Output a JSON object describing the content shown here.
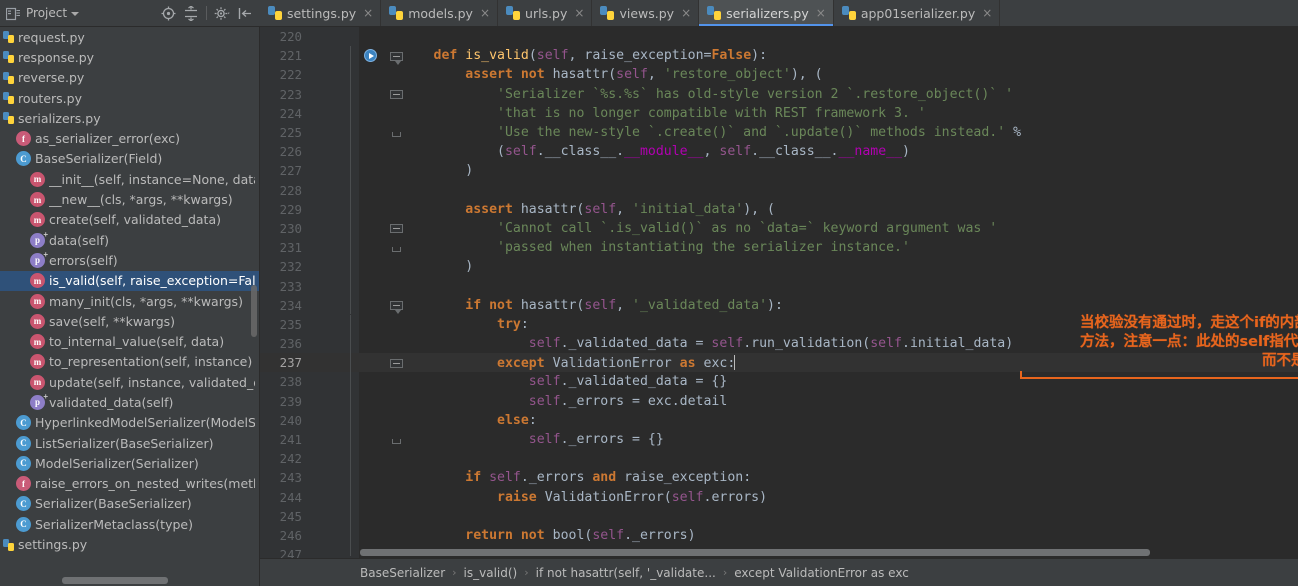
{
  "window": {
    "theme_bg": "#2b2b2b",
    "panel_bg": "#3c3f41",
    "accent": "#5394ec",
    "annotation_color": "#e8651d"
  },
  "project_panel": {
    "title": "Project",
    "icon": "project-view-icon",
    "caret": "chevron-down-icon",
    "toolbar": [
      {
        "name": "locate-in-tree-icon",
        "glyph": "target"
      },
      {
        "name": "collapse-all-icon",
        "glyph": "collapse"
      },
      {
        "name": "settings-gear-icon",
        "glyph": "gear"
      },
      {
        "name": "hide-panel-icon",
        "glyph": "hide"
      }
    ]
  },
  "tree": {
    "items": [
      {
        "label": "request.py",
        "icon": "python-file-icon",
        "indent": 0,
        "selected": false
      },
      {
        "label": "response.py",
        "icon": "python-file-icon",
        "indent": 0,
        "selected": false
      },
      {
        "label": "reverse.py",
        "icon": "python-file-icon",
        "indent": 0,
        "selected": false
      },
      {
        "label": "routers.py",
        "icon": "python-file-icon",
        "indent": 0,
        "selected": false
      },
      {
        "label": "serializers.py",
        "icon": "python-file-icon",
        "indent": 0,
        "selected": false
      },
      {
        "label": "as_serializer_error(exc)",
        "icon": "function-icon",
        "indent": 1,
        "selected": false
      },
      {
        "label": "BaseSerializer(Field)",
        "icon": "class-icon",
        "indent": 1,
        "selected": false
      },
      {
        "label": "__init__(self, instance=None, data=emp",
        "icon": "method-icon",
        "indent": 2,
        "selected": false
      },
      {
        "label": "__new__(cls, *args, **kwargs)",
        "icon": "method-icon",
        "indent": 2,
        "selected": false
      },
      {
        "label": "create(self, validated_data)",
        "icon": "method-icon",
        "indent": 2,
        "selected": false
      },
      {
        "label": "data(self)",
        "icon": "property-icon",
        "indent": 2,
        "selected": false
      },
      {
        "label": "errors(self)",
        "icon": "property-icon",
        "indent": 2,
        "selected": false
      },
      {
        "label": "is_valid(self, raise_exception=False)",
        "icon": "method-icon",
        "indent": 2,
        "selected": true
      },
      {
        "label": "many_init(cls, *args, **kwargs)",
        "icon": "method-icon",
        "indent": 2,
        "selected": false
      },
      {
        "label": "save(self, **kwargs)",
        "icon": "method-icon",
        "indent": 2,
        "selected": false
      },
      {
        "label": "to_internal_value(self, data)",
        "icon": "method-icon",
        "indent": 2,
        "selected": false
      },
      {
        "label": "to_representation(self, instance)",
        "icon": "method-icon",
        "indent": 2,
        "selected": false
      },
      {
        "label": "update(self, instance, validated_data)",
        "icon": "method-icon",
        "indent": 2,
        "selected": false
      },
      {
        "label": "validated_data(self)",
        "icon": "property-icon",
        "indent": 2,
        "selected": false
      },
      {
        "label": "HyperlinkedModelSerializer(ModelSeriali",
        "icon": "class-icon",
        "indent": 1,
        "selected": false
      },
      {
        "label": "ListSerializer(BaseSerializer)",
        "icon": "class-icon",
        "indent": 1,
        "selected": false
      },
      {
        "label": "ModelSerializer(Serializer)",
        "icon": "class-icon",
        "indent": 1,
        "selected": false
      },
      {
        "label": "raise_errors_on_nested_writes(method_na",
        "icon": "function-icon",
        "indent": 1,
        "selected": false
      },
      {
        "label": "Serializer(BaseSerializer)",
        "icon": "class-icon",
        "indent": 1,
        "selected": false
      },
      {
        "label": "SerializerMetaclass(type)",
        "icon": "class-icon",
        "indent": 1,
        "selected": false
      },
      {
        "label": "settings.py",
        "icon": "python-file-icon",
        "indent": 0,
        "selected": false
      }
    ]
  },
  "tabs": [
    {
      "label": "settings.py",
      "active": false,
      "close": "×"
    },
    {
      "label": "models.py",
      "active": false,
      "close": "×"
    },
    {
      "label": "urls.py",
      "active": false,
      "close": "×"
    },
    {
      "label": "views.py",
      "active": false,
      "close": "×"
    },
    {
      "label": "serializers.py",
      "active": true,
      "close": "×"
    },
    {
      "label": "app01serializer.py",
      "active": false,
      "close": "×"
    }
  ],
  "editor": {
    "first_line": 220,
    "current_line": 237,
    "lines": [
      {
        "n": 220,
        "tokens": []
      },
      {
        "n": 221,
        "gutter": "run-icon",
        "fold": "open-arrow",
        "tokens": [
          {
            "t": "        ",
            "c": "pln"
          },
          {
            "t": "def ",
            "c": "kw"
          },
          {
            "t": "is_valid",
            "c": "fn"
          },
          {
            "t": "(",
            "c": "pln"
          },
          {
            "t": "self",
            "c": "slf"
          },
          {
            "t": ", raise_exception=",
            "c": "pln"
          },
          {
            "t": "False",
            "c": "kw"
          },
          {
            "t": "):",
            "c": "pln"
          }
        ]
      },
      {
        "n": 222,
        "tokens": [
          {
            "t": "            ",
            "c": "pln"
          },
          {
            "t": "assert not ",
            "c": "kw"
          },
          {
            "t": "hasattr(",
            "c": "pln"
          },
          {
            "t": "self",
            "c": "slf"
          },
          {
            "t": ", ",
            "c": "pln"
          },
          {
            "t": "'restore_object'",
            "c": "str"
          },
          {
            "t": "), (",
            "c": "pln"
          }
        ]
      },
      {
        "n": 223,
        "fold": "open",
        "tokens": [
          {
            "t": "                ",
            "c": "pln"
          },
          {
            "t": "'Serializer `%s.%s` has old-style version 2 `.restore_object()` '",
            "c": "str"
          }
        ]
      },
      {
        "n": 224,
        "tokens": [
          {
            "t": "                ",
            "c": "pln"
          },
          {
            "t": "'that is no longer compatible with REST framework 3. '",
            "c": "str"
          }
        ]
      },
      {
        "n": 225,
        "fold": "end",
        "tokens": [
          {
            "t": "                ",
            "c": "pln"
          },
          {
            "t": "'Use the new-style `.create()` and `.update()` methods instead.'",
            "c": "str"
          },
          {
            "t": " %",
            "c": "pln"
          }
        ]
      },
      {
        "n": 226,
        "tokens": [
          {
            "t": "                (",
            "c": "pln"
          },
          {
            "t": "self",
            "c": "slf"
          },
          {
            "t": ".__class__.",
            "c": "pln"
          },
          {
            "t": "__module__",
            "c": "dnd"
          },
          {
            "t": ", ",
            "c": "pln"
          },
          {
            "t": "self",
            "c": "slf"
          },
          {
            "t": ".__class__.",
            "c": "pln"
          },
          {
            "t": "__name__",
            "c": "dnd"
          },
          {
            "t": ")",
            "c": "pln"
          }
        ]
      },
      {
        "n": 227,
        "tokens": [
          {
            "t": "            )",
            "c": "pln"
          }
        ]
      },
      {
        "n": 228,
        "tokens": []
      },
      {
        "n": 229,
        "tokens": [
          {
            "t": "            ",
            "c": "pln"
          },
          {
            "t": "assert ",
            "c": "kw"
          },
          {
            "t": "hasattr(",
            "c": "pln"
          },
          {
            "t": "self",
            "c": "slf"
          },
          {
            "t": ", ",
            "c": "pln"
          },
          {
            "t": "'initial_data'",
            "c": "str"
          },
          {
            "t": "), (",
            "c": "pln"
          }
        ]
      },
      {
        "n": 230,
        "fold": "open",
        "tokens": [
          {
            "t": "                ",
            "c": "pln"
          },
          {
            "t": "'Cannot call `.is_valid()` as no `data=` keyword argument was '",
            "c": "str"
          }
        ]
      },
      {
        "n": 231,
        "fold": "end",
        "tokens": [
          {
            "t": "                ",
            "c": "pln"
          },
          {
            "t": "'passed when instantiating the serializer instance.'",
            "c": "str"
          }
        ]
      },
      {
        "n": 232,
        "tokens": [
          {
            "t": "            )",
            "c": "pln"
          }
        ]
      },
      {
        "n": 233,
        "tokens": []
      },
      {
        "n": 234,
        "fold": "open-arrow",
        "tokens": [
          {
            "t": "            ",
            "c": "pln"
          },
          {
            "t": "if not ",
            "c": "kw"
          },
          {
            "t": "hasattr(",
            "c": "pln"
          },
          {
            "t": "self",
            "c": "slf"
          },
          {
            "t": ", ",
            "c": "pln"
          },
          {
            "t": "'_validated_data'",
            "c": "str"
          },
          {
            "t": "):",
            "c": "pln"
          }
        ]
      },
      {
        "n": 235,
        "tokens": [
          {
            "t": "                ",
            "c": "pln"
          },
          {
            "t": "try",
            "c": "kw"
          },
          {
            "t": ":",
            "c": "pln"
          }
        ]
      },
      {
        "n": 236,
        "tokens": [
          {
            "t": "                    ",
            "c": "pln"
          },
          {
            "t": "self",
            "c": "slf"
          },
          {
            "t": "._validated_data = ",
            "c": "pln"
          },
          {
            "t": "self",
            "c": "slf"
          },
          {
            "t": ".run_validation(",
            "c": "pln"
          },
          {
            "t": "self",
            "c": "slf"
          },
          {
            "t": ".initial_data)",
            "c": "pln"
          }
        ]
      },
      {
        "n": 237,
        "current": true,
        "fold": "open",
        "tokens": [
          {
            "t": "                ",
            "c": "pln"
          },
          {
            "t": "except ",
            "c": "kw"
          },
          {
            "t": "ValidationError ",
            "c": "cls"
          },
          {
            "t": "as ",
            "c": "kw"
          },
          {
            "t": "exc",
            "c": "pln"
          },
          {
            "t": ":",
            "c": "pln"
          }
        ],
        "caret_after": true
      },
      {
        "n": 238,
        "tokens": [
          {
            "t": "                    ",
            "c": "pln"
          },
          {
            "t": "self",
            "c": "slf"
          },
          {
            "t": "._validated_data = {}",
            "c": "pln"
          }
        ]
      },
      {
        "n": 239,
        "tokens": [
          {
            "t": "                    ",
            "c": "pln"
          },
          {
            "t": "self",
            "c": "slf"
          },
          {
            "t": "._errors = exc.detail",
            "c": "pln"
          }
        ]
      },
      {
        "n": 240,
        "tokens": [
          {
            "t": "                ",
            "c": "pln"
          },
          {
            "t": "else",
            "c": "kw"
          },
          {
            "t": ":",
            "c": "pln"
          }
        ]
      },
      {
        "n": 241,
        "fold": "end",
        "tokens": [
          {
            "t": "                    ",
            "c": "pln"
          },
          {
            "t": "self",
            "c": "slf"
          },
          {
            "t": "._errors = {}",
            "c": "pln"
          }
        ]
      },
      {
        "n": 242,
        "tokens": []
      },
      {
        "n": 243,
        "tokens": [
          {
            "t": "            ",
            "c": "pln"
          },
          {
            "t": "if ",
            "c": "kw"
          },
          {
            "t": "self",
            "c": "slf"
          },
          {
            "t": "._errors ",
            "c": "pln"
          },
          {
            "t": "and ",
            "c": "kw"
          },
          {
            "t": "raise_exception:",
            "c": "pln"
          }
        ]
      },
      {
        "n": 244,
        "tokens": [
          {
            "t": "                ",
            "c": "pln"
          },
          {
            "t": "raise ",
            "c": "kw"
          },
          {
            "t": "ValidationError(",
            "c": "pln"
          },
          {
            "t": "self",
            "c": "slf"
          },
          {
            "t": ".errors)",
            "c": "pln"
          }
        ]
      },
      {
        "n": 245,
        "tokens": []
      },
      {
        "n": 246,
        "tokens": [
          {
            "t": "            ",
            "c": "pln"
          },
          {
            "t": "return not ",
            "c": "kw"
          },
          {
            "t": "bool(",
            "c": "pln"
          },
          {
            "t": "self",
            "c": "slf"
          },
          {
            "t": "._errors)",
            "c": "pln"
          }
        ]
      },
      {
        "n": 247,
        "tokens": []
      }
    ]
  },
  "annotation": {
    "line1": "当校验没有通过时，走这个if的内部，在执行这个run_validation",
    "line2": "方法，注意一点：此处的self指代的是继承这个serializer类的子类",
    "line3": "而不是此处的serializers父类"
  },
  "breadcrumb": {
    "sep": "›",
    "items": [
      "BaseSerializer",
      "is_valid()",
      "if not hasattr(self, '_validate...",
      "except ValidationError as exc"
    ]
  }
}
